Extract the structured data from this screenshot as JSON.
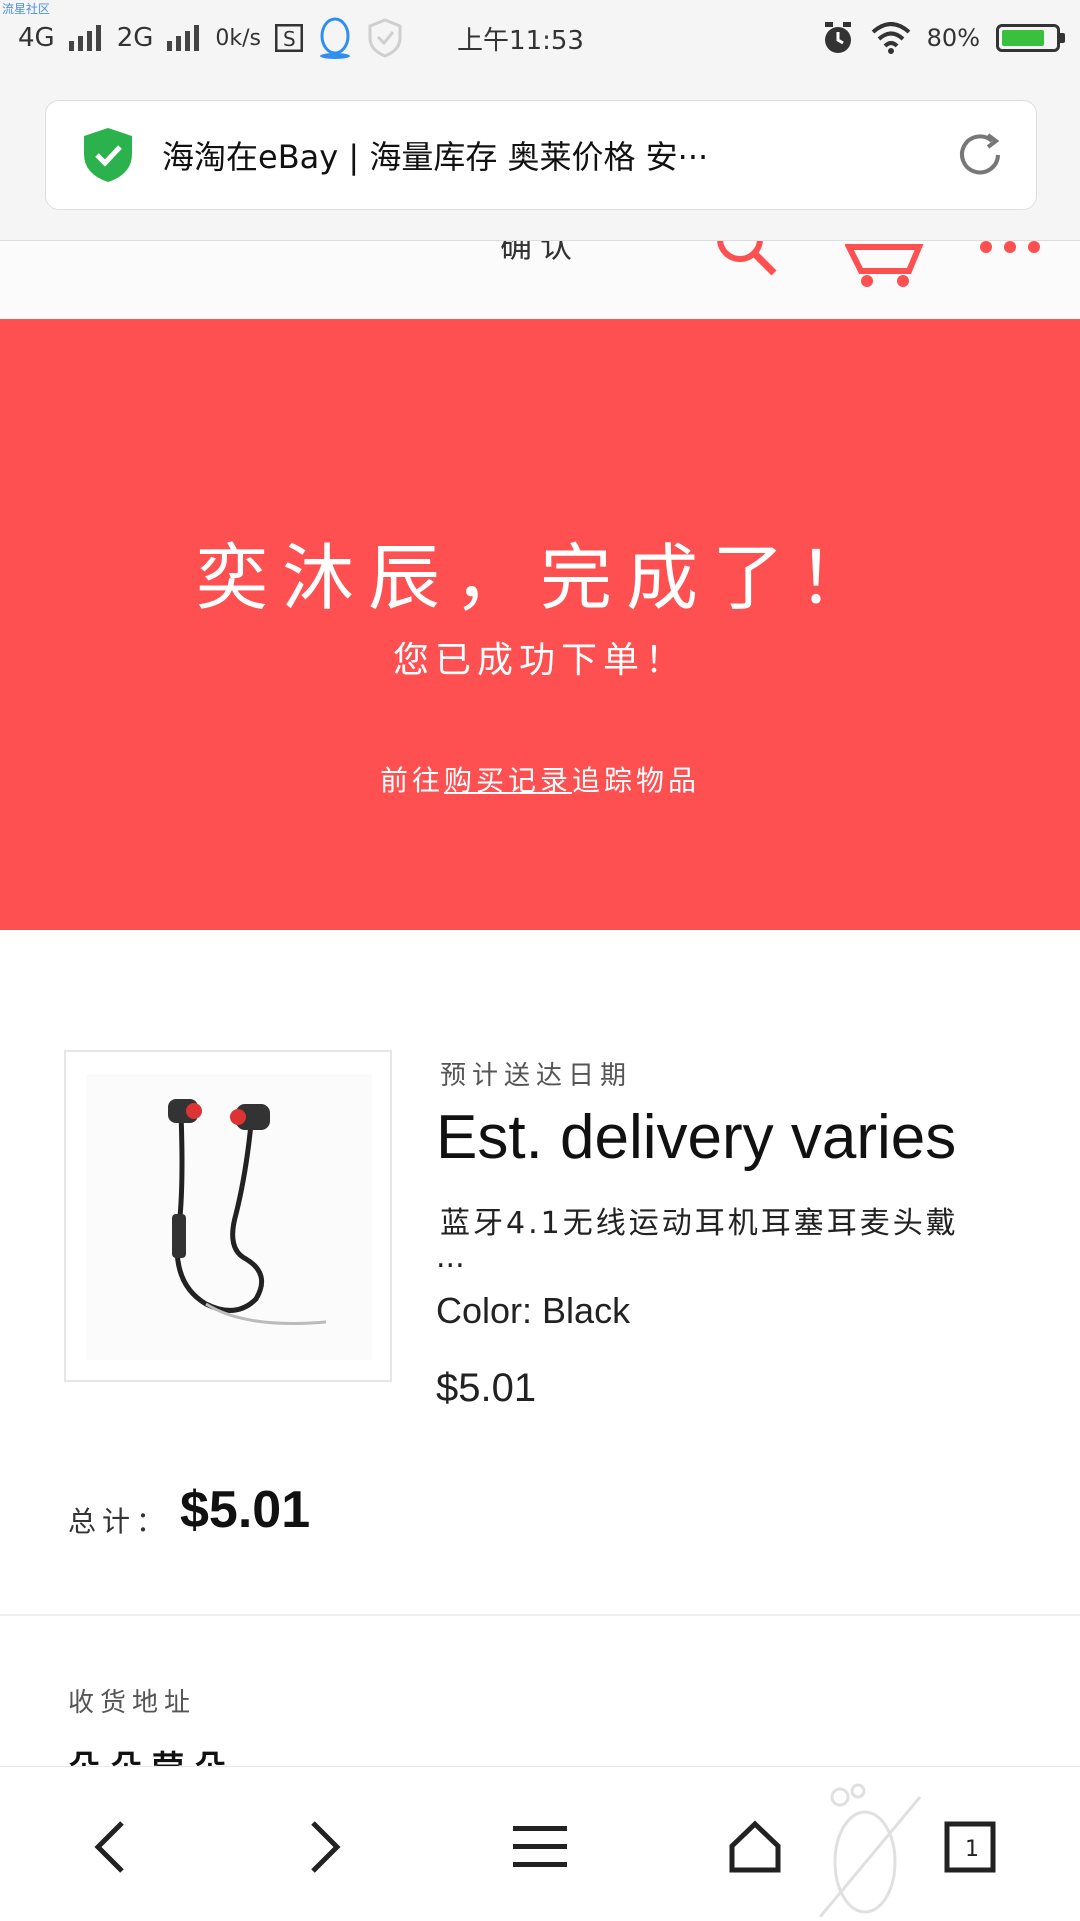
{
  "status_bar": {
    "watermark": "流星社区",
    "network_1": "4G",
    "network_2": "2G",
    "speed": "0k/s",
    "time": "上午11:53",
    "battery": "80%",
    "battery_level": 0.8
  },
  "browser": {
    "page_title": "海淘在eBay | 海量库存 奥莱价格 安···"
  },
  "site_header": {
    "title": "确认"
  },
  "banner": {
    "title": "奕沐辰，完成了！",
    "subtitle": "您已成功下单！",
    "link_prefix": "前往",
    "link_text": "购买记录",
    "link_suffix": "追踪物品"
  },
  "order": {
    "delivery_label": "预计送达日期",
    "delivery_value": "Est. delivery varies",
    "item_name": "蓝牙4.1无线运动耳机耳塞耳麦头戴",
    "item_ellipsis": "...",
    "item_color": "Color: Black",
    "item_price": "$5.01",
    "total_label": "总计：",
    "total_value": "$5.01"
  },
  "shipping": {
    "label": "收货地址",
    "name": "朵朵莹朵"
  },
  "colors": {
    "accent": "#fe5050",
    "shield": "#2bb24c"
  }
}
